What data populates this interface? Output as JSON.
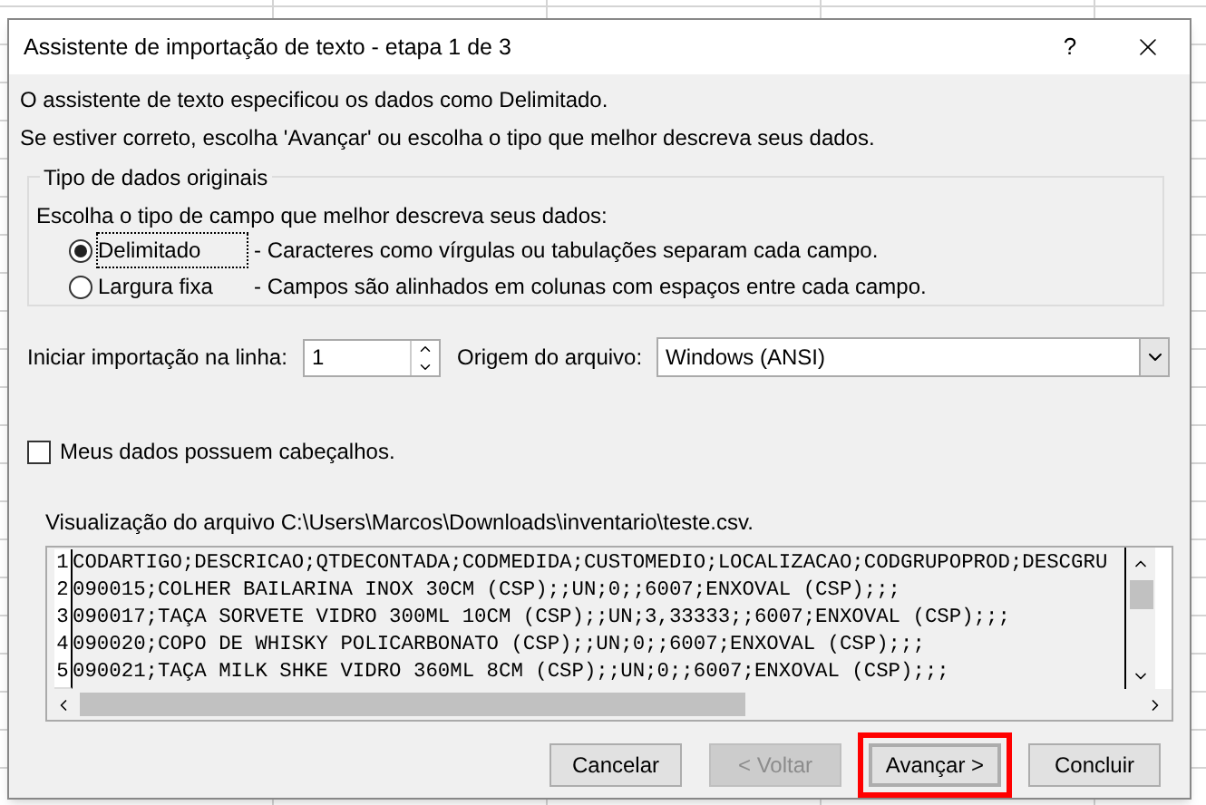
{
  "window": {
    "title": "Assistente de importação de texto - etapa 1 de 3",
    "help": "?"
  },
  "intro": [
    "O assistente de texto especificou os dados como Delimitado.",
    "Se estiver correto, escolha 'Avançar' ou escolha o tipo que melhor descreva seus dados."
  ],
  "group": {
    "title": "Tipo de dados originais",
    "prompt": "Escolha o tipo de campo que melhor descreva seus dados:",
    "options": [
      {
        "label": "Delimitado",
        "description": "- Caracteres como vírgulas ou tabulações separam cada campo.",
        "selected": true
      },
      {
        "label": "Largura fixa",
        "description": "- Campos são alinhados em colunas com espaços entre cada campo.",
        "selected": false
      }
    ]
  },
  "start_row": {
    "label": "Iniciar importação na linha:",
    "value": "1"
  },
  "file_origin": {
    "label": "Origem do arquivo:",
    "value": "Windows (ANSI)"
  },
  "headers_checkbox": {
    "label": "Meus dados possuem cabeçalhos.",
    "checked": false
  },
  "preview": {
    "title": "Visualização do arquivo C:\\Users\\Marcos\\Downloads\\inventario\\teste.csv.",
    "rows": [
      {
        "number": "1",
        "text": "CODARTIGO;DESCRICAO;QTDECONTADA;CODMEDIDA;CUSTOMEDIO;LOCALIZACAO;CODGRUPOPROD;DESCGRU"
      },
      {
        "number": "2",
        "text": "090015;COLHER BAILARINA INOX 30CM (CSP);;UN;0;;6007;ENXOVAL (CSP);;;"
      },
      {
        "number": "3",
        "text": "090017;TAÇA SORVETE VIDRO 300ML 10CM (CSP);;UN;3,33333;;6007;ENXOVAL (CSP);;;"
      },
      {
        "number": "4",
        "text": "090020;COPO DE WHISKY POLICARBONATO (CSP);;UN;0;;6007;ENXOVAL (CSP);;;"
      },
      {
        "number": "5",
        "text": "090021;TAÇA MILK SHKE VIDRO 360ML 8CM (CSP);;UN;0;;6007;ENXOVAL (CSP);;;"
      }
    ]
  },
  "buttons": [
    {
      "label": "Cancelar",
      "disabled": false,
      "highlighted": false
    },
    {
      "label": "< Voltar",
      "disabled": true,
      "highlighted": false
    },
    {
      "label": "Avançar >",
      "disabled": false,
      "highlighted": true
    },
    {
      "label": "Concluir",
      "disabled": false,
      "highlighted": false
    }
  ]
}
